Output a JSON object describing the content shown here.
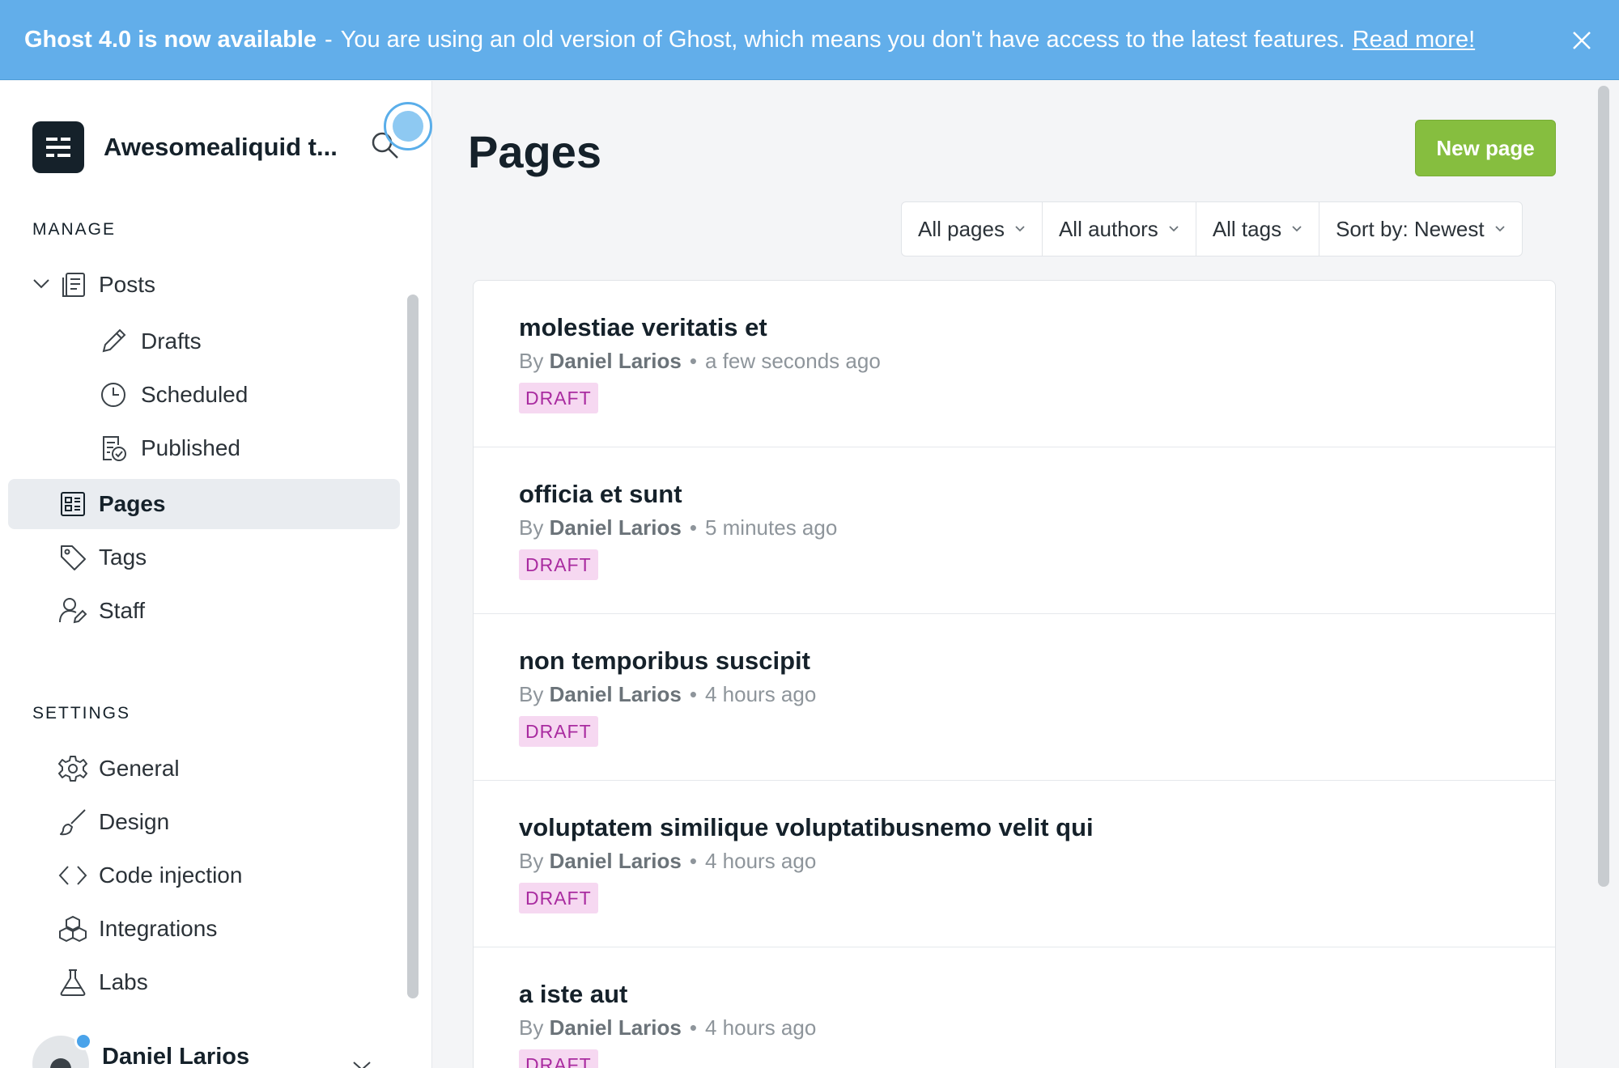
{
  "banner": {
    "strong": "Ghost 4.0 is now available",
    "sep": "-",
    "message": "You are using an old version of Ghost, which means you don't have access to the latest features.",
    "link": "Read more!"
  },
  "sidebar": {
    "site_name": "Awesomealiquid t...",
    "manage_title": "MANAGE",
    "settings_title": "SETTINGS",
    "manage_items": [
      {
        "label": "Posts",
        "icon": "posts-icon"
      },
      {
        "label": "Drafts",
        "icon": "pencil-icon"
      },
      {
        "label": "Scheduled",
        "icon": "clock-icon"
      },
      {
        "label": "Published",
        "icon": "published-icon"
      },
      {
        "label": "Pages",
        "icon": "pages-icon",
        "active": true
      },
      {
        "label": "Tags",
        "icon": "tag-icon"
      },
      {
        "label": "Staff",
        "icon": "staff-icon"
      }
    ],
    "settings_items": [
      {
        "label": "General",
        "icon": "gear-icon"
      },
      {
        "label": "Design",
        "icon": "brush-icon"
      },
      {
        "label": "Code injection",
        "icon": "code-icon"
      },
      {
        "label": "Integrations",
        "icon": "integrations-icon"
      },
      {
        "label": "Labs",
        "icon": "flask-icon"
      }
    ],
    "user_name": "Daniel Larios"
  },
  "main": {
    "title": "Pages",
    "new_button": "New page",
    "filters": [
      "All pages",
      "All authors",
      "All tags",
      "Sort by: Newest"
    ],
    "rows": [
      {
        "title": "molestiae veritatis et",
        "by": "By",
        "author": "Daniel Larios",
        "dot": "•",
        "time": "a few seconds ago",
        "status": "DRAFT"
      },
      {
        "title": "officia et sunt",
        "by": "By",
        "author": "Daniel Larios",
        "dot": "•",
        "time": "5 minutes ago",
        "status": "DRAFT"
      },
      {
        "title": "non temporibus suscipit",
        "by": "By",
        "author": "Daniel Larios",
        "dot": "•",
        "time": "4 hours ago",
        "status": "DRAFT"
      },
      {
        "title": "voluptatem similique voluptatibusnemo velit qui",
        "by": "By",
        "author": "Daniel Larios",
        "dot": "•",
        "time": "4 hours ago",
        "status": "DRAFT"
      },
      {
        "title": "a iste aut",
        "by": "By",
        "author": "Daniel Larios",
        "dot": "•",
        "time": "4 hours ago",
        "status": "DRAFT"
      }
    ]
  },
  "colors": {
    "banner": "#62aeea",
    "primary_button": "#86be3f",
    "draft_badge_bg": "#f6d8f1",
    "draft_badge_text": "#a92ba0"
  }
}
